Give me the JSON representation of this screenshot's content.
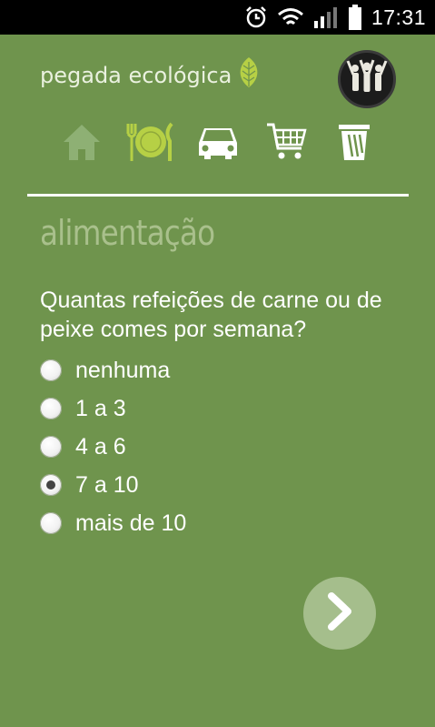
{
  "status_bar": {
    "time": "17:31",
    "icons": [
      "alarm-icon",
      "wifi-icon",
      "signal-icon",
      "battery-icon"
    ]
  },
  "header": {
    "brand": "pegada ecológica",
    "brand_icon": "leaf-icon",
    "menu_icon": "community-icon"
  },
  "nav": {
    "tabs": [
      {
        "name": "home",
        "icon": "home-icon",
        "state": "disabled"
      },
      {
        "name": "food",
        "icon": "plate-icon",
        "state": "active"
      },
      {
        "name": "transport",
        "icon": "car-icon",
        "state": "normal"
      },
      {
        "name": "shopping",
        "icon": "cart-icon",
        "state": "normal"
      },
      {
        "name": "waste",
        "icon": "trash-icon",
        "state": "normal"
      }
    ]
  },
  "section": {
    "title": "alimentação"
  },
  "question": {
    "text": "Quantas refeições de carne ou de peixe comes por semana?",
    "options": [
      "nenhuma",
      "1 a 3",
      "4 a 6",
      "7 a 10",
      "mais de 10"
    ],
    "selected": "7 a 10"
  },
  "next_button": {
    "icon": "chevron-right-icon"
  },
  "colors": {
    "background": "#6f944d",
    "title_muted": "#a9c08c",
    "active_tab": "#b6d045",
    "next_button": "#a5be8c"
  }
}
